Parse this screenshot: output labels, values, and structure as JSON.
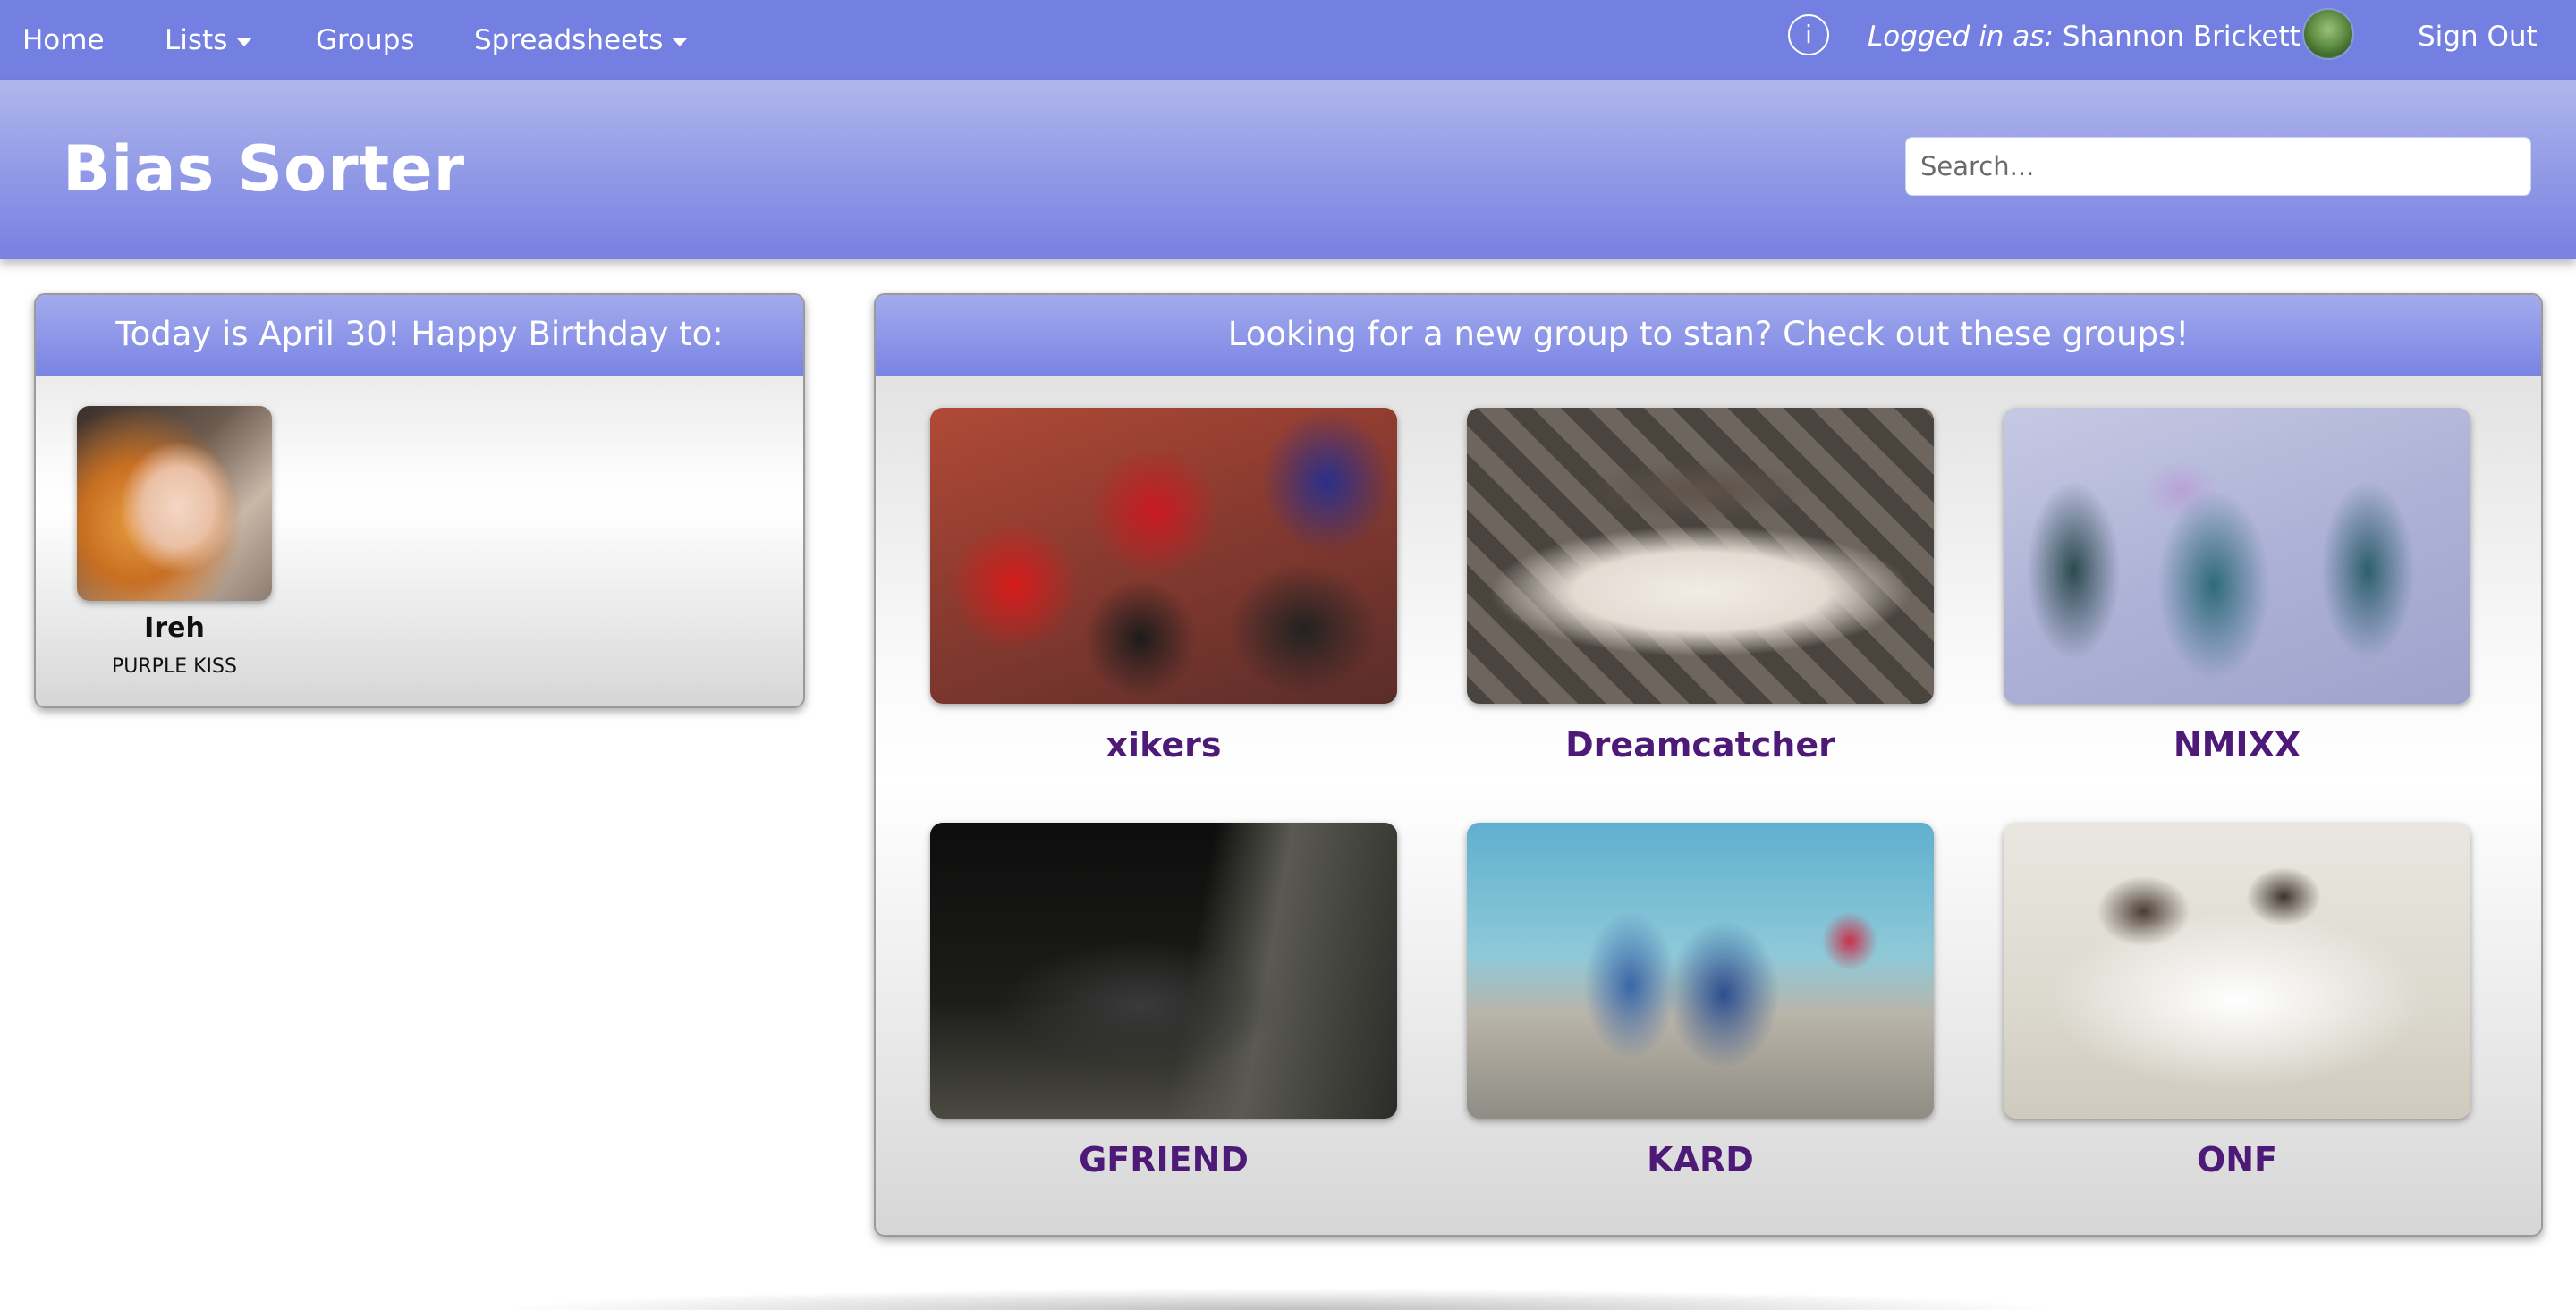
{
  "nav": {
    "home": "Home",
    "lists": "Lists",
    "groups": "Groups",
    "spreadsheets": "Spreadsheets",
    "logged_prefix": "Logged in as:",
    "user_name": "Shannon Brickett",
    "sign_out": "Sign Out",
    "info_symbol": "i"
  },
  "header": {
    "site_title": "Bias Sorter",
    "search_placeholder": "Search..."
  },
  "birthday_panel": {
    "title": "Today is April 30! Happy Birthday to:",
    "people": [
      {
        "name": "Ireh",
        "group": "PURPLE KISS"
      }
    ]
  },
  "groups_panel": {
    "title": "Looking for a new group to stan? Check out these groups!",
    "groups": [
      {
        "name": "xikers"
      },
      {
        "name": "Dreamcatcher"
      },
      {
        "name": "NMIXX"
      },
      {
        "name": "GFRIEND"
      },
      {
        "name": "KARD"
      },
      {
        "name": "ONF"
      }
    ]
  },
  "colors": {
    "navbar": "#747fe2",
    "group_name": "#4e1a78",
    "panel_head": "#7a84e3"
  }
}
